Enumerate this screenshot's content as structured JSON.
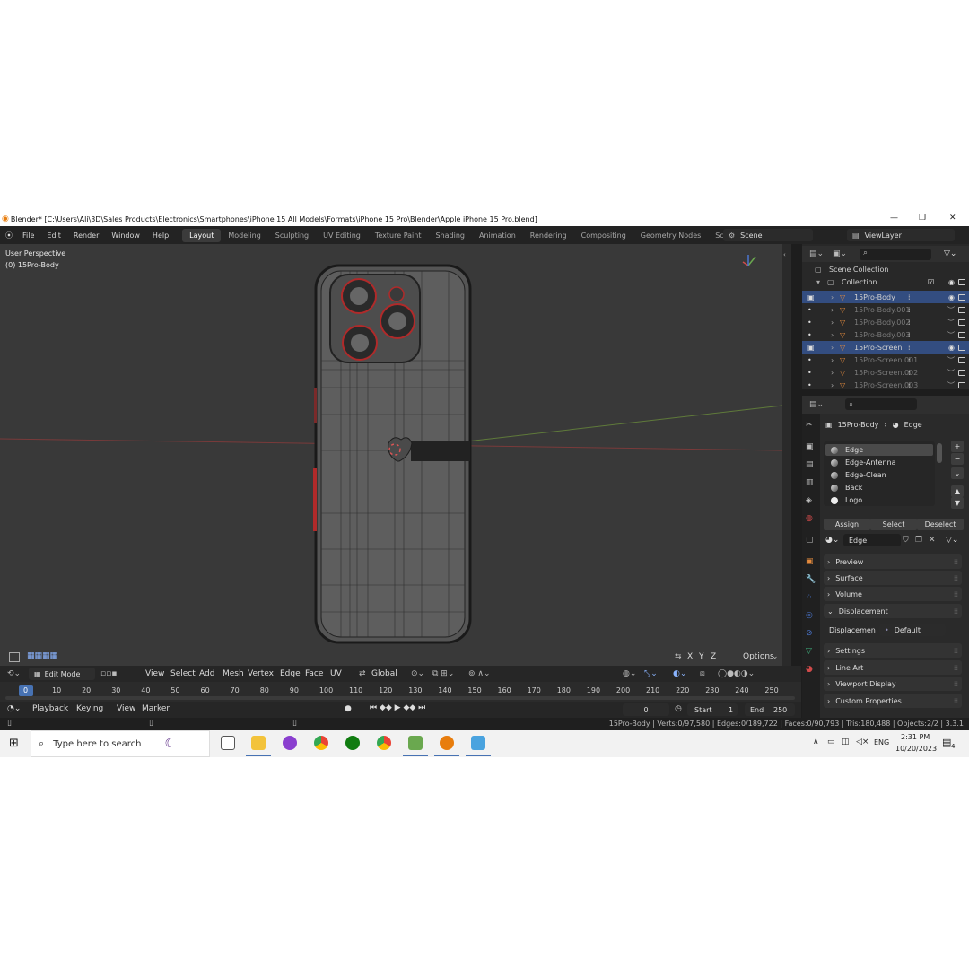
{
  "window": {
    "title": "Blender* [C:\\Users\\Ali\\3D\\Sales Products\\Electronics\\Smartphones\\iPhone 15 All Models\\Formats\\iPhone 15 Pro\\Blender\\Apple iPhone 15 Pro.blend]",
    "min": "—",
    "max": "❐",
    "close": "✕"
  },
  "menu": [
    "File",
    "Edit",
    "Render",
    "Window",
    "Help"
  ],
  "workspaces": [
    "Layout",
    "Modeling",
    "Sculpting",
    "UV Editing",
    "Texture Paint",
    "Shading",
    "Animation",
    "Rendering",
    "Compositing",
    "Geometry Nodes",
    "Scripting",
    "+"
  ],
  "scene": "Scene",
  "view_layer": "ViewLayer",
  "viewport": {
    "perspective": "User Perspective",
    "object": "(0) 15Pro-Body",
    "options": "Options",
    "axes": [
      "X",
      "Y",
      "Z"
    ]
  },
  "header3d": {
    "mode": "Edit Mode",
    "menus": [
      "View",
      "Select",
      "Add",
      "Mesh",
      "Vertex",
      "Edge",
      "Face",
      "UV"
    ],
    "transform": "Global"
  },
  "outliner": {
    "scene_collection": "Scene Collection",
    "collection": "Collection",
    "items": [
      "15Pro-Body",
      "15Pro-Body.001",
      "15Pro-Body.002",
      "15Pro-Body.003",
      "15Pro-Screen",
      "15Pro-Screen.001",
      "15Pro-Screen.002",
      "15Pro-Screen.003"
    ]
  },
  "properties": {
    "object": "15Pro-Body",
    "material": "Edge",
    "slots": [
      "Edge",
      "Edge-Antenna",
      "Edge-Clean",
      "Back",
      "Logo"
    ],
    "assign": "Assign",
    "select": "Select",
    "deselect": "Deselect",
    "material_field": "Edge",
    "panels_top": [
      "Preview",
      "Surface",
      "Volume",
      "Displacement"
    ],
    "displacement_label": "Displacemen",
    "displacement_value": "Default",
    "panels_bottom": [
      "Settings",
      "Line Art",
      "Viewport Display",
      "Custom Properties"
    ]
  },
  "timeline": {
    "ticks": [
      "0",
      "10",
      "20",
      "30",
      "40",
      "50",
      "60",
      "70",
      "80",
      "90",
      "100",
      "110",
      "120",
      "130",
      "140",
      "150",
      "160",
      "170",
      "180",
      "190",
      "200",
      "210",
      "220",
      "230",
      "240",
      "250"
    ],
    "menus": [
      "Playback",
      "Keying",
      "View",
      "Marker"
    ],
    "current": "0",
    "start_label": "Start",
    "start": "1",
    "end_label": "End",
    "end": "250"
  },
  "status": "15Pro-Body | Verts:0/97,580 | Edges:0/189,722 | Faces:0/90,793 | Tris:180,488 | Objects:2/2 | 3.3.1",
  "taskbar": {
    "search": "Type here to search",
    "lang": "ENG",
    "time": "2:31 PM",
    "date": "10/20/2023",
    "notif": "4"
  },
  "colors": {
    "accent": "#4772b3",
    "selection": "#334d80",
    "orange": "#e38a3d",
    "viewport": "#393939"
  }
}
